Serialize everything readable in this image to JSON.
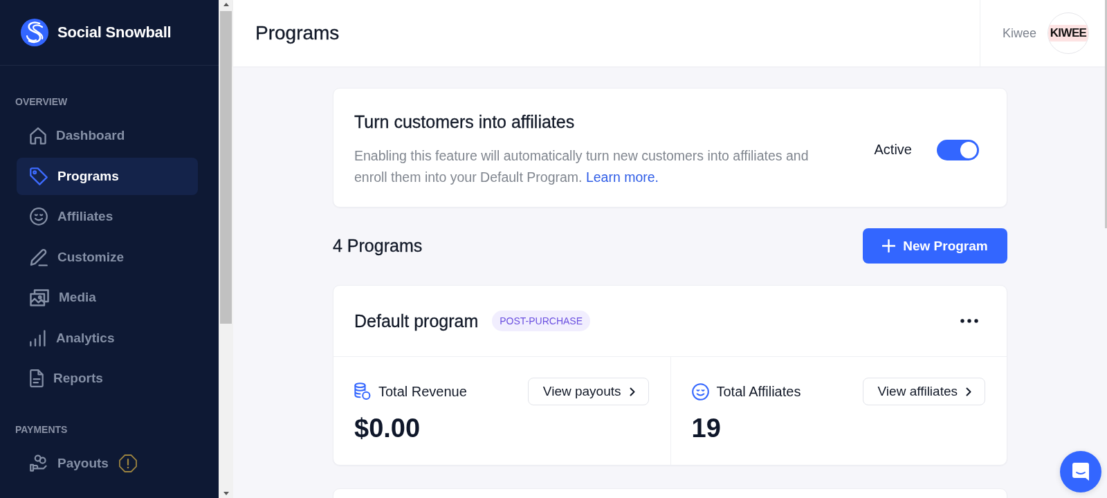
{
  "sidebar": {
    "brand": "Social Snowball",
    "sections": [
      {
        "heading": "OVERVIEW",
        "items": [
          {
            "kind": "dashboard",
            "label": "Dashboard",
            "selected": false,
            "alert": false
          },
          {
            "kind": "programs",
            "label": "Programs",
            "selected": true,
            "alert": false
          },
          {
            "kind": "affiliates",
            "label": "Affiliates",
            "selected": false,
            "alert": false
          },
          {
            "kind": "customize",
            "label": "Customize",
            "selected": false,
            "alert": false
          },
          {
            "kind": "media",
            "label": "Media",
            "selected": false,
            "alert": false
          },
          {
            "kind": "analytics",
            "label": "Analytics",
            "selected": false,
            "alert": false
          },
          {
            "kind": "reports",
            "label": "Reports",
            "selected": false,
            "alert": false
          }
        ]
      },
      {
        "heading": "PAYMENTS",
        "items": [
          {
            "kind": "payouts",
            "label": "Payouts",
            "selected": false,
            "alert": true
          }
        ]
      }
    ]
  },
  "header": {
    "title": "Programs",
    "account_name": "Kiwee",
    "avatar_text": "KIWEE"
  },
  "feature_card": {
    "title": "Turn customers into affiliates",
    "description": "Enabling this feature will automatically turn new customers into affiliates and enroll them into your Default Program.",
    "link": "Learn more.",
    "toggle_label": "Active",
    "toggle_on": true
  },
  "programs": {
    "count_label": "4 Programs",
    "new_button": "New Program",
    "cards": [
      {
        "name": "Default program",
        "badge": "POST-PURCHASE",
        "stats": [
          {
            "kind": "revenue",
            "label": "Total Revenue",
            "value": "$0.00",
            "button": "View payouts"
          },
          {
            "kind": "affiliates",
            "label": "Total Affiliates",
            "value": "19",
            "button": "View affiliates"
          }
        ]
      }
    ]
  }
}
